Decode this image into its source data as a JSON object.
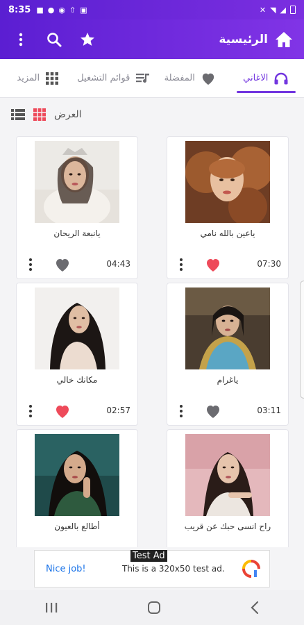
{
  "status_bar": {
    "time": "8:35"
  },
  "app_bar": {
    "title": "الرئيسية"
  },
  "tabs": [
    {
      "label": "الاغاني",
      "icon": "headphones-icon",
      "active": true
    },
    {
      "label": "المفضلة",
      "icon": "heart-icon",
      "active": false
    },
    {
      "label": "قوائم التشغيل",
      "icon": "playlist-icon",
      "active": false
    },
    {
      "label": "المزيد",
      "icon": "grid-icon",
      "active": false
    }
  ],
  "view": {
    "label": "العرض"
  },
  "songs": [
    {
      "title": "ياعين بالله نامي",
      "duration": "07:30",
      "favorite": true
    },
    {
      "title": "يانبعة الريحان",
      "duration": "04:43",
      "favorite": false
    },
    {
      "title": "ياغرام",
      "duration": "03:11",
      "favorite": false
    },
    {
      "title": "مكانك خالي",
      "duration": "02:57",
      "favorite": true
    },
    {
      "title": "راح انسى حبك عن قريب",
      "duration": "",
      "favorite": false
    },
    {
      "title": "أطالع بالعيون",
      "duration": "",
      "favorite": false
    }
  ],
  "ad": {
    "tag": "Test Ad",
    "headline": "Nice job!",
    "body": "This is a 320x50 test ad."
  },
  "colors": {
    "accent": "#7236df",
    "favorite": "#ee4a5a",
    "not_favorite": "#6b6b70"
  }
}
